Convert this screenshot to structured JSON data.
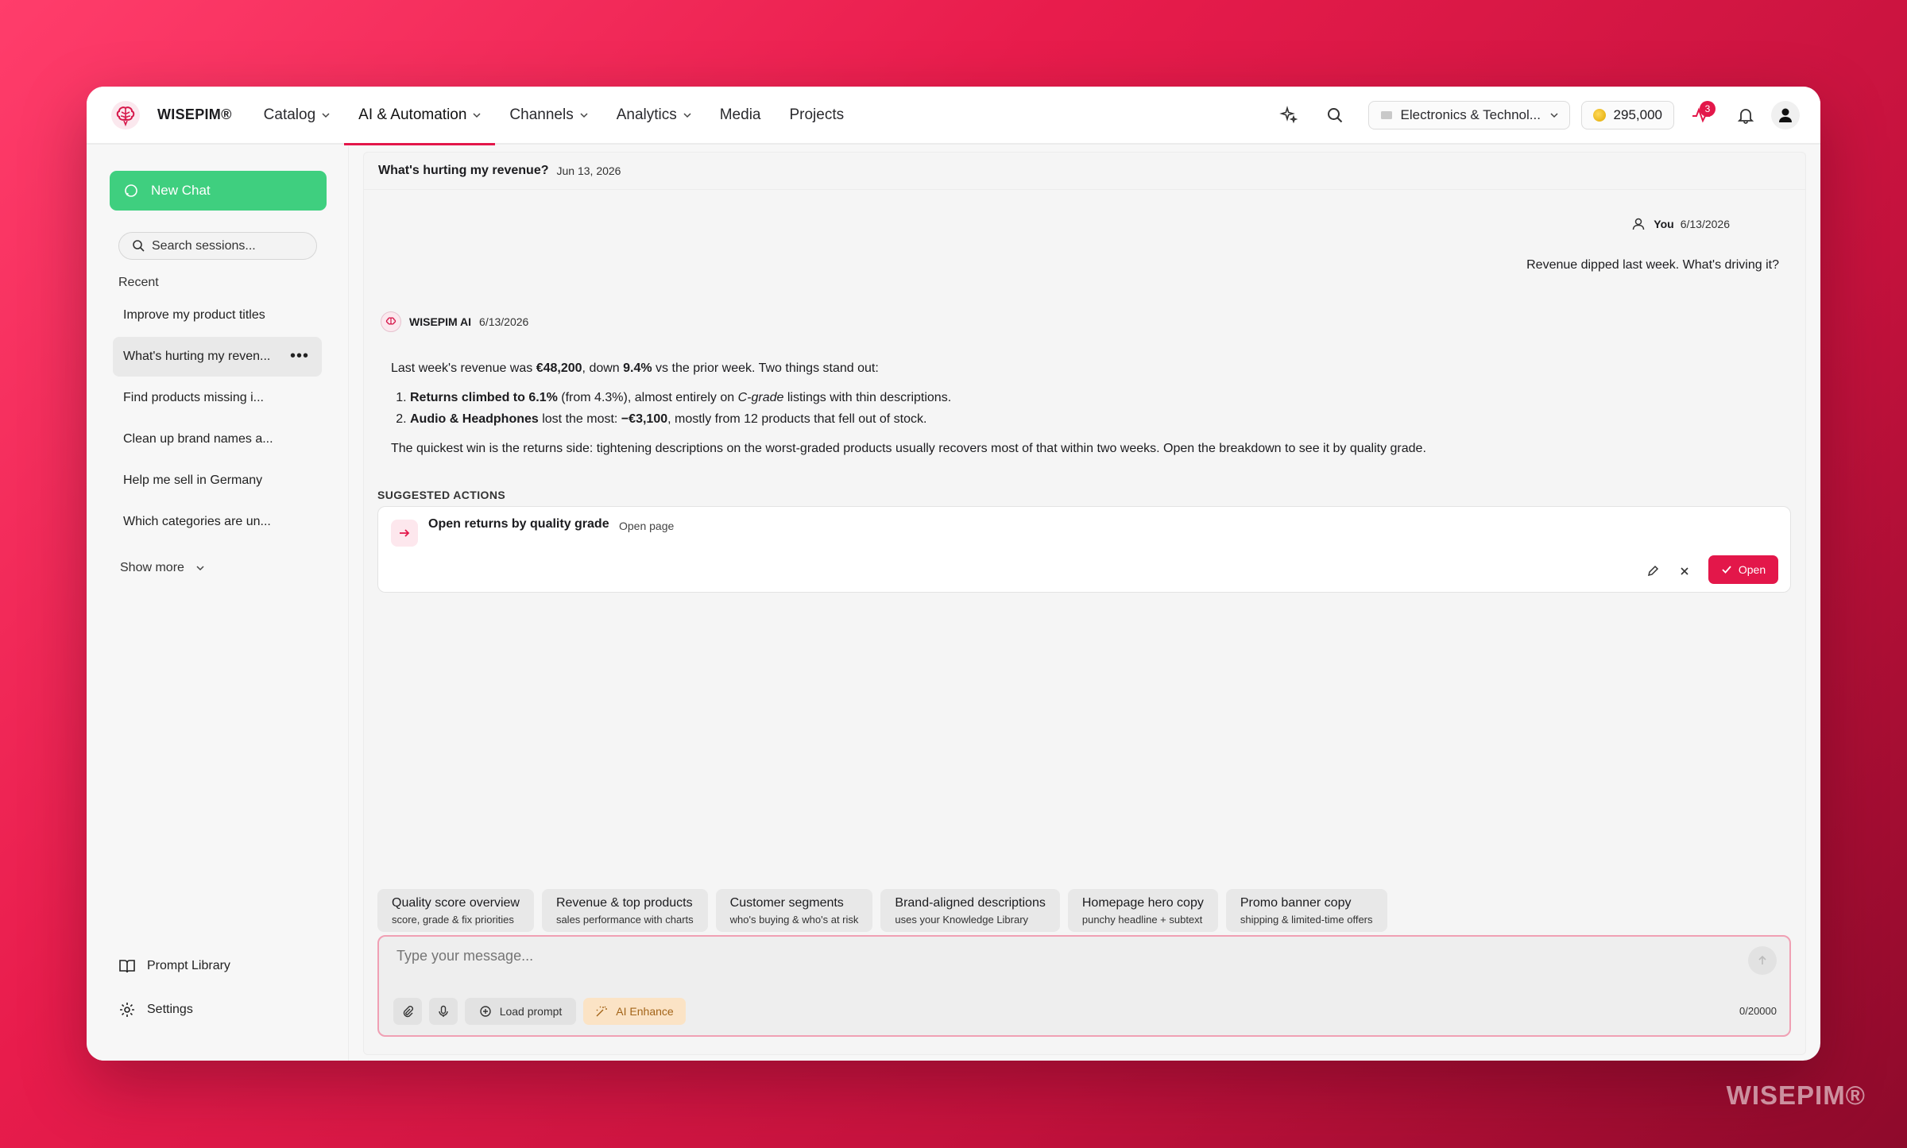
{
  "nav": {
    "brand": "WISEPIM®",
    "items": [
      {
        "label": "Catalog",
        "dropdown": true
      },
      {
        "label": "AI & Automation",
        "dropdown": true,
        "active": true
      },
      {
        "label": "Channels",
        "dropdown": true
      },
      {
        "label": "Analytics",
        "dropdown": true
      },
      {
        "label": "Media",
        "dropdown": false
      },
      {
        "label": "Projects",
        "dropdown": false
      }
    ],
    "store_select": "Electronics & Technol...",
    "credits": "295,000",
    "activity_badge": "3"
  },
  "sidebar": {
    "new_chat": "New Chat",
    "search_placeholder": "Search sessions...",
    "recent_label": "Recent",
    "sessions": [
      "Improve my product titles",
      "What's hurting my reven...",
      "Find products missing i...",
      "Clean up brand names a...",
      "Help me sell in Germany",
      "Which categories are un..."
    ],
    "active_session": 1,
    "session_more": "•••",
    "show_more": "Show more",
    "prompt_library": "Prompt Library",
    "settings": "Settings"
  },
  "chat": {
    "title": "What's hurting my revenue?",
    "date": "Jun 13, 2026",
    "user_name": "You",
    "user_date": "6/13/2026",
    "user_message": "Revenue dipped last week. What's driving it?",
    "ai_name": "WISEPIM AI",
    "ai_date": "6/13/2026",
    "ai": {
      "p1_a": "Last week's revenue was ",
      "p1_b": "€48,200",
      "p1_c": ", down ",
      "p1_d": "9.4%",
      "p1_e": " vs the prior week. Two things stand out:",
      "li1_a": "Returns climbed to 6.1%",
      "li1_b": " (from 4.3%), almost entirely on ",
      "li1_c": "C-grade",
      "li1_d": " listings with thin descriptions.",
      "li2_a": "Audio & Headphones",
      "li2_b": " lost the most: ",
      "li2_c": "−€3,100",
      "li2_d": ", mostly from 12 products that fell out of stock.",
      "p2": "The quickest win is the returns side: tightening descriptions on the worst-graded products usually recovers most of that within two weeks. Open the breakdown to see it by quality grade."
    },
    "suggested_label": "SUGGESTED ACTIONS",
    "action": {
      "title": "Open returns by quality grade",
      "subtitle": "Open page",
      "open_label": "Open"
    },
    "chips": [
      {
        "title": "Quality score overview",
        "sub": "score, grade & fix priorities"
      },
      {
        "title": "Revenue & top products",
        "sub": "sales performance with charts"
      },
      {
        "title": "Customer segments",
        "sub": "who's buying & who's at risk"
      },
      {
        "title": "Brand-aligned descriptions",
        "sub": "uses your Knowledge Library"
      },
      {
        "title": "Homepage hero copy",
        "sub": "punchy headline + subtext"
      },
      {
        "title": "Promo banner copy",
        "sub": "shipping & limited-time offers"
      }
    ],
    "composer": {
      "placeholder": "Type your message...",
      "load_prompt": "Load prompt",
      "ai_enhance": "AI Enhance",
      "counter": "0/20000"
    }
  },
  "watermark": "WISEPIM®",
  "colors": {
    "accent": "#e3174a",
    "new_chat": "#3fcf7f",
    "enhance_bg": "#fbe3c5"
  }
}
